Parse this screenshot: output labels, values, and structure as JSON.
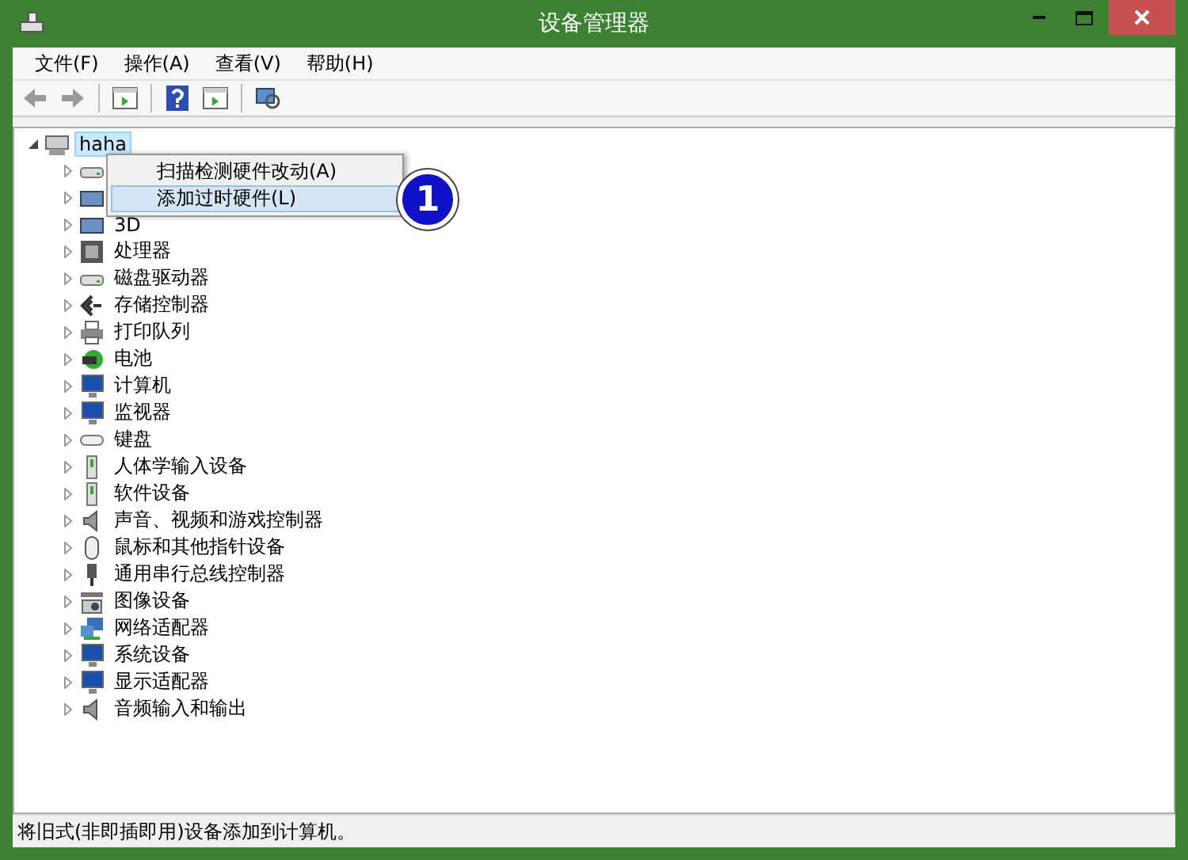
{
  "window": {
    "title": "设备管理器"
  },
  "menu": [
    "文件(F)",
    "操作(A)",
    "查看(V)",
    "帮助(H)"
  ],
  "tree": {
    "label": "haha",
    "expanded": true,
    "selected": true,
    "children": [
      {
        "kind": "disk",
        "expanded": false
      },
      {
        "kind": "card",
        "expanded": false
      },
      {
        "kind": "card",
        "label": "3D",
        "expanded": false
      },
      {
        "kind": "chip",
        "label": "处理器",
        "expanded": false
      },
      {
        "kind": "disk",
        "label": "磁盘驱动器",
        "expanded": false
      },
      {
        "kind": "diamond",
        "label": "存储控制器",
        "expanded": false
      },
      {
        "kind": "printer",
        "label": "打印队列",
        "expanded": false
      },
      {
        "kind": "battery",
        "label": "电池",
        "expanded": false
      },
      {
        "kind": "monitor",
        "label": "计算机",
        "expanded": false
      },
      {
        "kind": "monitor",
        "label": "监视器",
        "expanded": false
      },
      {
        "kind": "keyboard",
        "label": "键盘",
        "expanded": false
      },
      {
        "kind": "device",
        "label": "人体学输入设备",
        "expanded": false
      },
      {
        "kind": "device",
        "label": "软件设备",
        "expanded": false
      },
      {
        "kind": "speaker",
        "label": "声音、视频和游戏控制器",
        "expanded": false
      },
      {
        "kind": "mouse",
        "label": "鼠标和其他指针设备",
        "expanded": false
      },
      {
        "kind": "plug",
        "label": "通用串行总线控制器",
        "expanded": false
      },
      {
        "kind": "camera",
        "label": "图像设备",
        "expanded": false
      },
      {
        "kind": "network",
        "label": "网络适配器",
        "expanded": false
      },
      {
        "kind": "monitor",
        "label": "系统设备",
        "expanded": false
      },
      {
        "kind": "monitor",
        "label": "显示适配器",
        "expanded": false
      },
      {
        "kind": "speaker",
        "label": "音频输入和输出",
        "expanded": false
      }
    ]
  },
  "context_menu": [
    {
      "label": "扫描检测硬件改动(A)",
      "selected": false
    },
    {
      "label": "添加过时硬件(L)",
      "selected": true
    }
  ],
  "callout": "1",
  "status_bar": "将旧式(非即插即用)设备添加到计算机。"
}
